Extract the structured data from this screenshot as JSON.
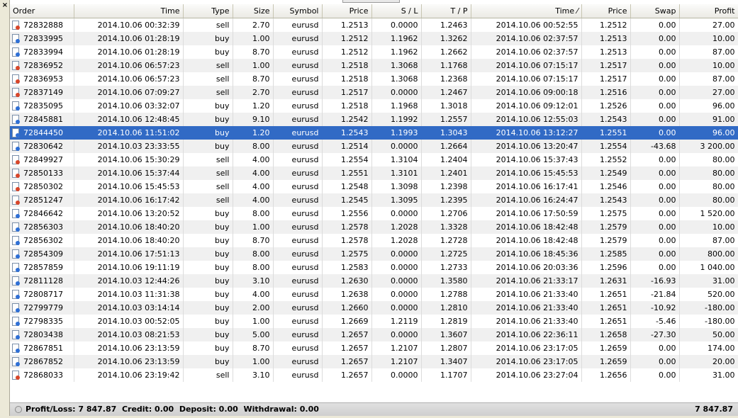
{
  "columns": [
    "Order",
    "Time",
    "Type",
    "Size",
    "Symbol",
    "Price",
    "S / L",
    "T / P",
    "Time  ⁄",
    "Price",
    "Swap",
    "Profit"
  ],
  "rows": [
    {
      "order": "72832888",
      "open_time": "2014.10.06 00:32:39",
      "type": "sell",
      "size": "2.70",
      "symbol": "eurusd",
      "open_price": "1.2513",
      "sl": "0.0000",
      "tp": "1.2463",
      "close_time": "2014.10.06 00:52:55",
      "close_price": "1.2512",
      "swap": "0.00",
      "profit": "27.00"
    },
    {
      "order": "72833995",
      "open_time": "2014.10.06 01:28:19",
      "type": "buy",
      "size": "1.00",
      "symbol": "eurusd",
      "open_price": "1.2512",
      "sl": "1.1962",
      "tp": "1.3262",
      "close_time": "2014.10.06 02:37:57",
      "close_price": "1.2513",
      "swap": "0.00",
      "profit": "10.00"
    },
    {
      "order": "72833994",
      "open_time": "2014.10.06 01:28:19",
      "type": "buy",
      "size": "8.70",
      "symbol": "eurusd",
      "open_price": "1.2512",
      "sl": "1.1962",
      "tp": "1.2662",
      "close_time": "2014.10.06 02:37:57",
      "close_price": "1.2513",
      "swap": "0.00",
      "profit": "87.00"
    },
    {
      "order": "72836952",
      "open_time": "2014.10.06 06:57:23",
      "type": "sell",
      "size": "1.00",
      "symbol": "eurusd",
      "open_price": "1.2518",
      "sl": "1.3068",
      "tp": "1.1768",
      "close_time": "2014.10.06 07:15:17",
      "close_price": "1.2517",
      "swap": "0.00",
      "profit": "10.00"
    },
    {
      "order": "72836953",
      "open_time": "2014.10.06 06:57:23",
      "type": "sell",
      "size": "8.70",
      "symbol": "eurusd",
      "open_price": "1.2518",
      "sl": "1.3068",
      "tp": "1.2368",
      "close_time": "2014.10.06 07:15:17",
      "close_price": "1.2517",
      "swap": "0.00",
      "profit": "87.00"
    },
    {
      "order": "72837149",
      "open_time": "2014.10.06 07:09:27",
      "type": "sell",
      "size": "2.70",
      "symbol": "eurusd",
      "open_price": "1.2517",
      "sl": "0.0000",
      "tp": "1.2467",
      "close_time": "2014.10.06 09:00:18",
      "close_price": "1.2516",
      "swap": "0.00",
      "profit": "27.00"
    },
    {
      "order": "72835095",
      "open_time": "2014.10.06 03:32:07",
      "type": "buy",
      "size": "1.20",
      "symbol": "eurusd",
      "open_price": "1.2518",
      "sl": "1.1968",
      "tp": "1.3018",
      "close_time": "2014.10.06 09:12:01",
      "close_price": "1.2526",
      "swap": "0.00",
      "profit": "96.00"
    },
    {
      "order": "72845881",
      "open_time": "2014.10.06 12:48:45",
      "type": "buy",
      "size": "9.10",
      "symbol": "eurusd",
      "open_price": "1.2542",
      "sl": "1.1992",
      "tp": "1.2557",
      "close_time": "2014.10.06 12:55:03",
      "close_price": "1.2543",
      "swap": "0.00",
      "profit": "91.00"
    },
    {
      "order": "72844450",
      "open_time": "2014.10.06 11:51:02",
      "type": "buy",
      "size": "1.20",
      "symbol": "eurusd",
      "open_price": "1.2543",
      "sl": "1.1993",
      "tp": "1.3043",
      "close_time": "2014.10.06 13:12:27",
      "close_price": "1.2551",
      "swap": "0.00",
      "profit": "96.00",
      "selected": true
    },
    {
      "order": "72830642",
      "open_time": "2014.10.03 23:33:55",
      "type": "buy",
      "size": "8.00",
      "symbol": "eurusd",
      "open_price": "1.2514",
      "sl": "0.0000",
      "tp": "1.2664",
      "close_time": "2014.10.06 13:20:47",
      "close_price": "1.2554",
      "swap": "-43.68",
      "profit": "3 200.00"
    },
    {
      "order": "72849927",
      "open_time": "2014.10.06 15:30:29",
      "type": "sell",
      "size": "4.00",
      "symbol": "eurusd",
      "open_price": "1.2554",
      "sl": "1.3104",
      "tp": "1.2404",
      "close_time": "2014.10.06 15:37:43",
      "close_price": "1.2552",
      "swap": "0.00",
      "profit": "80.00"
    },
    {
      "order": "72850133",
      "open_time": "2014.10.06 15:37:44",
      "type": "sell",
      "size": "4.00",
      "symbol": "eurusd",
      "open_price": "1.2551",
      "sl": "1.3101",
      "tp": "1.2401",
      "close_time": "2014.10.06 15:45:53",
      "close_price": "1.2549",
      "swap": "0.00",
      "profit": "80.00"
    },
    {
      "order": "72850302",
      "open_time": "2014.10.06 15:45:53",
      "type": "sell",
      "size": "4.00",
      "symbol": "eurusd",
      "open_price": "1.2548",
      "sl": "1.3098",
      "tp": "1.2398",
      "close_time": "2014.10.06 16:17:41",
      "close_price": "1.2546",
      "swap": "0.00",
      "profit": "80.00"
    },
    {
      "order": "72851247",
      "open_time": "2014.10.06 16:17:42",
      "type": "sell",
      "size": "4.00",
      "symbol": "eurusd",
      "open_price": "1.2545",
      "sl": "1.3095",
      "tp": "1.2395",
      "close_time": "2014.10.06 16:24:47",
      "close_price": "1.2543",
      "swap": "0.00",
      "profit": "80.00"
    },
    {
      "order": "72846642",
      "open_time": "2014.10.06 13:20:52",
      "type": "buy",
      "size": "8.00",
      "symbol": "eurusd",
      "open_price": "1.2556",
      "sl": "0.0000",
      "tp": "1.2706",
      "close_time": "2014.10.06 17:50:59",
      "close_price": "1.2575",
      "swap": "0.00",
      "profit": "1 520.00"
    },
    {
      "order": "72856303",
      "open_time": "2014.10.06 18:40:20",
      "type": "buy",
      "size": "1.00",
      "symbol": "eurusd",
      "open_price": "1.2578",
      "sl": "1.2028",
      "tp": "1.3328",
      "close_time": "2014.10.06 18:42:48",
      "close_price": "1.2579",
      "swap": "0.00",
      "profit": "10.00"
    },
    {
      "order": "72856302",
      "open_time": "2014.10.06 18:40:20",
      "type": "buy",
      "size": "8.70",
      "symbol": "eurusd",
      "open_price": "1.2578",
      "sl": "1.2028",
      "tp": "1.2728",
      "close_time": "2014.10.06 18:42:48",
      "close_price": "1.2579",
      "swap": "0.00",
      "profit": "87.00"
    },
    {
      "order": "72854309",
      "open_time": "2014.10.06 17:51:13",
      "type": "buy",
      "size": "8.00",
      "symbol": "eurusd",
      "open_price": "1.2575",
      "sl": "0.0000",
      "tp": "1.2725",
      "close_time": "2014.10.06 18:45:36",
      "close_price": "1.2585",
      "swap": "0.00",
      "profit": "800.00"
    },
    {
      "order": "72857859",
      "open_time": "2014.10.06 19:11:19",
      "type": "buy",
      "size": "8.00",
      "symbol": "eurusd",
      "open_price": "1.2583",
      "sl": "0.0000",
      "tp": "1.2733",
      "close_time": "2014.10.06 20:03:36",
      "close_price": "1.2596",
      "swap": "0.00",
      "profit": "1 040.00"
    },
    {
      "order": "72811128",
      "open_time": "2014.10.03 12:44:26",
      "type": "buy",
      "size": "3.10",
      "symbol": "eurusd",
      "open_price": "1.2630",
      "sl": "0.0000",
      "tp": "1.3580",
      "close_time": "2014.10.06 21:33:17",
      "close_price": "1.2631",
      "swap": "-16.93",
      "profit": "31.00"
    },
    {
      "order": "72808717",
      "open_time": "2014.10.03 11:31:38",
      "type": "buy",
      "size": "4.00",
      "symbol": "eurusd",
      "open_price": "1.2638",
      "sl": "0.0000",
      "tp": "1.2788",
      "close_time": "2014.10.06 21:33:40",
      "close_price": "1.2651",
      "swap": "-21.84",
      "profit": "520.00"
    },
    {
      "order": "72799779",
      "open_time": "2014.10.03 03:14:14",
      "type": "buy",
      "size": "2.00",
      "symbol": "eurusd",
      "open_price": "1.2660",
      "sl": "0.0000",
      "tp": "1.2810",
      "close_time": "2014.10.06 21:33:40",
      "close_price": "1.2651",
      "swap": "-10.92",
      "profit": "-180.00"
    },
    {
      "order": "72798335",
      "open_time": "2014.10.03 00:52:05",
      "type": "buy",
      "size": "1.00",
      "symbol": "eurusd",
      "open_price": "1.2669",
      "sl": "1.2119",
      "tp": "1.2819",
      "close_time": "2014.10.06 21:33:40",
      "close_price": "1.2651",
      "swap": "-5.46",
      "profit": "-180.00"
    },
    {
      "order": "72803438",
      "open_time": "2014.10.03 08:21:53",
      "type": "buy",
      "size": "5.00",
      "symbol": "eurusd",
      "open_price": "1.2657",
      "sl": "0.0000",
      "tp": "1.3607",
      "close_time": "2014.10.06 22:36:11",
      "close_price": "1.2658",
      "swap": "-27.30",
      "profit": "50.00"
    },
    {
      "order": "72867851",
      "open_time": "2014.10.06 23:13:59",
      "type": "buy",
      "size": "8.70",
      "symbol": "eurusd",
      "open_price": "1.2657",
      "sl": "1.2107",
      "tp": "1.2807",
      "close_time": "2014.10.06 23:17:05",
      "close_price": "1.2659",
      "swap": "0.00",
      "profit": "174.00"
    },
    {
      "order": "72867852",
      "open_time": "2014.10.06 23:13:59",
      "type": "buy",
      "size": "1.00",
      "symbol": "eurusd",
      "open_price": "1.2657",
      "sl": "1.2107",
      "tp": "1.3407",
      "close_time": "2014.10.06 23:17:05",
      "close_price": "1.2659",
      "swap": "0.00",
      "profit": "20.00"
    },
    {
      "order": "72868033",
      "open_time": "2014.10.06 23:19:42",
      "type": "sell",
      "size": "3.10",
      "symbol": "eurusd",
      "open_price": "1.2657",
      "sl": "0.0000",
      "tp": "1.1707",
      "close_time": "2014.10.06 23:27:04",
      "close_price": "1.2656",
      "swap": "0.00",
      "profit": "31.00"
    }
  ],
  "status": {
    "summary": "Profit/Loss: 7 847.87  Credit: 0.00  Deposit: 0.00  Withdrawal: 0.00",
    "total": "7 847.87"
  },
  "window": {
    "close_glyph": "×"
  },
  "icons": {
    "ticket": "order-ticket-icon",
    "status": "status-circle-icon",
    "close": "close-icon"
  },
  "colors": {
    "selected_row": "#316ac5",
    "buy_marker": "#2e6fd6",
    "sell_marker": "#d8462a"
  }
}
